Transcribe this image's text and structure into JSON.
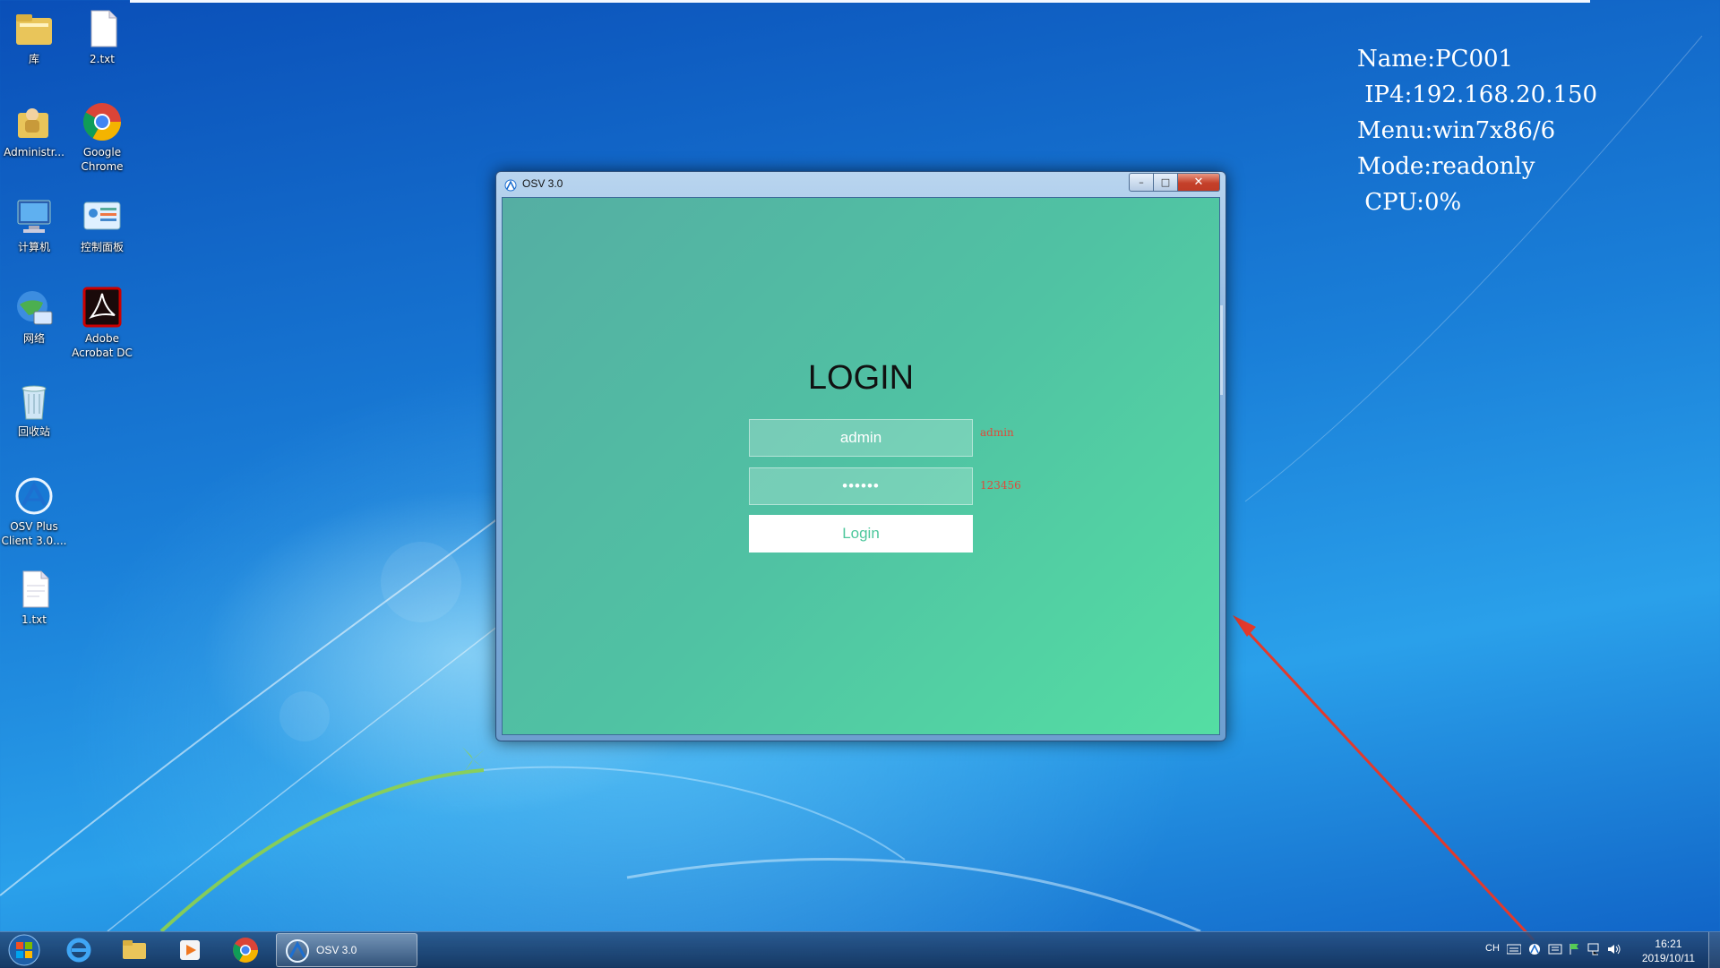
{
  "desktop": {
    "icons": [
      {
        "label": "库"
      },
      {
        "label": "2.txt"
      },
      {
        "label": "Administr..."
      },
      {
        "label": "Google Chrome"
      },
      {
        "label": "计算机"
      },
      {
        "label": "控制面板"
      },
      {
        "label": "网络"
      },
      {
        "label": "Adobe Acrobat DC"
      },
      {
        "label": "回收站"
      },
      {
        "label": "OSV Plus Client 3.0...."
      },
      {
        "label": "1.txt"
      }
    ]
  },
  "info_panel": {
    "rows": [
      {
        "key": "Name:",
        "value": "PC001"
      },
      {
        "key": " IP4:",
        "value": "192.168.20.150"
      },
      {
        "key": "Menu:",
        "value": "win7x86/6"
      },
      {
        "key": "Mode:",
        "value": "readonly"
      },
      {
        "key": " CPU:",
        "value": "0%"
      }
    ]
  },
  "window": {
    "title": "OSV 3.0",
    "login": {
      "heading": "LOGIN",
      "username_value": "admin",
      "password_value": "123456",
      "username_hint": "admin",
      "password_hint": "123456",
      "button_label": "Login"
    },
    "colors": {
      "accent": "#4dc79c",
      "hint": "#e04a3a"
    }
  },
  "taskbar": {
    "active_app_label": "OSV 3.0",
    "language": "CH",
    "time": "16:21",
    "date": "2019/10/11"
  }
}
